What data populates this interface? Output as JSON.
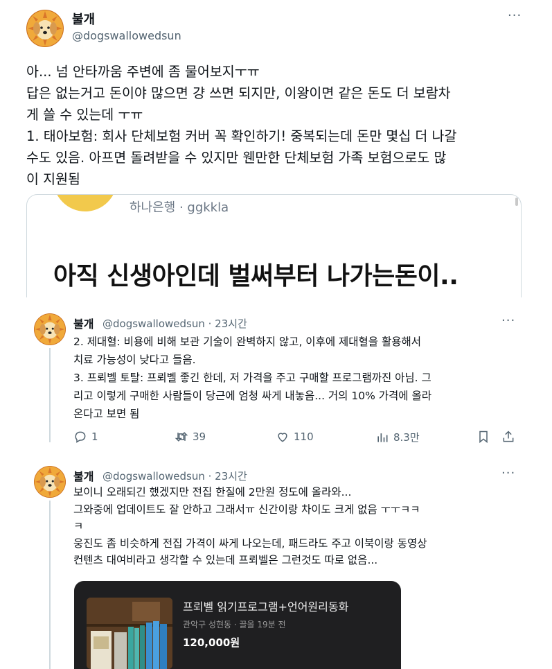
{
  "main_post": {
    "name": "불개",
    "handle": "@dogswallowedsun",
    "more": "···",
    "lines": [
      "아... 넘 안타까움 주변에 좀 물어보지ㅜㅠ",
      "답은 없는거고 돈이야 많으면 걍 쓰면 되지만, 이왕이면 같은 돈도 더 보람차",
      "게 쓸 수 있는데 ㅜㅠ",
      "1. 태아보험: 회사 단체보험 커버 꼭 확인하기! 중복되는데 돈만 몇십 더 나갈",
      "수도 있음. 아프면 돌려받을 수 있지만 웬만한 단체보험 가족 보험으로도 많",
      "이 지원됨"
    ]
  },
  "quote_card": {
    "source": "하나은행 · ggkkla",
    "title": "아직 신생아인데 벌써부터 나가는돈이.."
  },
  "reply1": {
    "name": "불개",
    "meta": "@dogswallowedsun · 23시간",
    "more": "···",
    "lines": [
      "2. 제대혈: 비용에 비해 보관 기술이 완벽하지 않고, 이후에 제대혈을 활용해서",
      "치료 가능성이 낮다고 들음.",
      "3. 프뢰벨 토탈: 프뢰벨 좋긴 한데, 저 가격을 주고 구매할 프로그램까진 아님. 그",
      "리고 이렇게 구매한 사람들이 당근에 엄청 싸게 내놓음... 거의 10% 가격에 올라",
      "온다고 보면 됨"
    ],
    "actions": {
      "reply_count": "1",
      "retweet_count": "39",
      "like_count": "110",
      "views_count": "8.3만"
    }
  },
  "reply2": {
    "name": "불개",
    "meta": "@dogswallowedsun · 23시간",
    "more": "···",
    "lines": [
      "보이니 오래되긴 했겠지만 전집 한질에 2만원 정도에 올라와...",
      "그와중에 업데이트도 잘 안하고 그래서ㅠ 신간이랑 차이도 크게 없음 ㅜㅜㅋㅋ",
      "ㅋ",
      "웅진도 좀 비슷하게 전집 가격이 싸게 나오는데, 패드라도 주고 이북이랑 동영상",
      "컨텐츠 대여비라고 생각할 수 있는데 프뢰벨은 그런것도 따로 없음..."
    ],
    "product": {
      "title": "프뢰벨 읽기프로그램+언어원리동화",
      "meta": "관악구 성현동 · 끌올 19분 전",
      "price": "120,000원"
    }
  },
  "colors": {
    "text": "#0f1419",
    "secondary": "#536471",
    "border": "#cfd9de",
    "product_bg": "#1f1f21"
  }
}
